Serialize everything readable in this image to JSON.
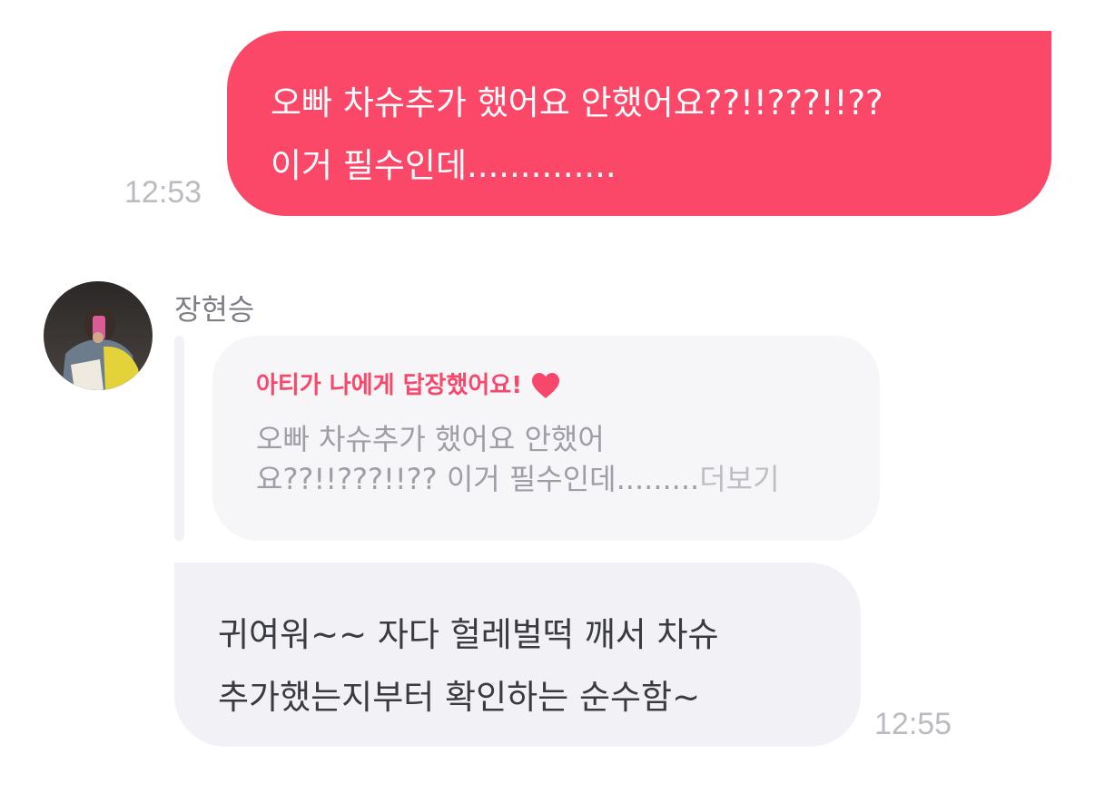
{
  "outgoing_message": {
    "lines": [
      "오빠 차슈추가 했어요 안했어요??!!???!!??",
      "이거 필수인데.............."
    ],
    "time": "12:53",
    "bubble_color": "#fb4868"
  },
  "incoming_message": {
    "sender_name": "장현승",
    "reply_card": {
      "title": "아티가 나에게 답장했어요!",
      "heart_icon": "heart-icon",
      "preview_lines": [
        "오빠 차슈추가 했어요 안했어",
        "요??!!???!!?? 이거 필수인데........."
      ],
      "more_label": "더보기",
      "accent_color": "#f7486c"
    },
    "lines": [
      "귀여워~~ 자다 헐레벌떡 깨서 차슈",
      "추가했는지부터 확인하는 순수함~"
    ],
    "time": "12:55",
    "bubble_color": "#f2f2f6"
  }
}
